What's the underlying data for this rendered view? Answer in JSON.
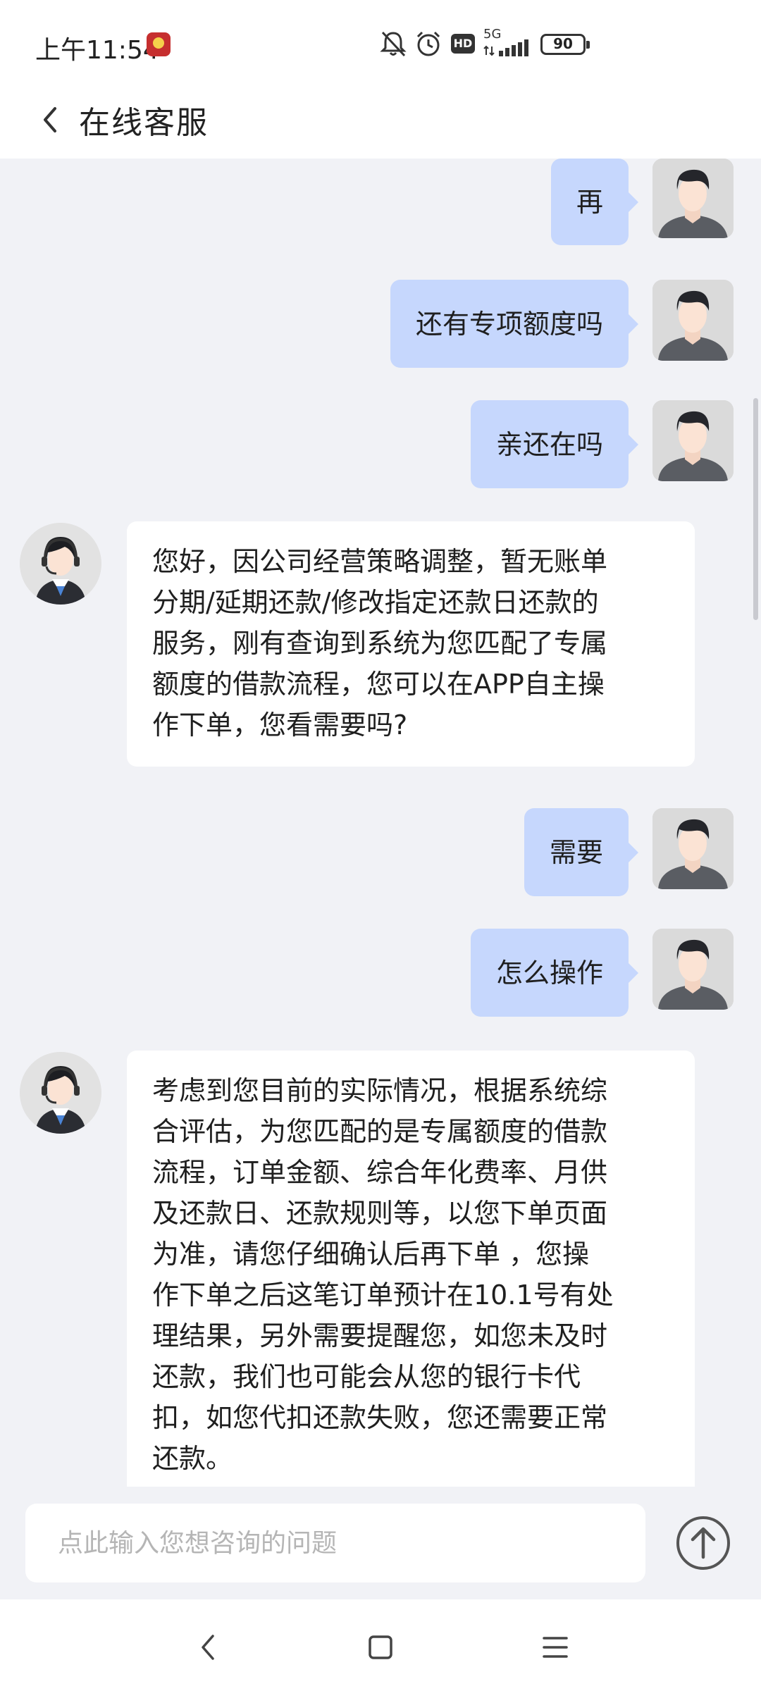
{
  "status_bar": {
    "time": "上午11:54",
    "network": "5G",
    "battery": "90",
    "icons": [
      "app-notification-icon",
      "mute-bell-icon",
      "alarm-icon",
      "hd-icon",
      "signal-icon",
      "battery-icon"
    ]
  },
  "header": {
    "title": "在线客服",
    "back_icon": "chevron-left-icon"
  },
  "messages": [
    {
      "from": "user",
      "text": "再"
    },
    {
      "from": "user",
      "text": "还有专项额度吗"
    },
    {
      "from": "user",
      "text": "亲还在吗"
    },
    {
      "from": "agent",
      "lines": [
        "您好，因公司经营策略调整，暂无账单",
        "分期/延期还款/修改指定还款日还款的",
        "服务，刚有查询到系统为您匹配了专属",
        "额度的借款流程，您可以在APP自主操",
        "作下单，您看需要吗?"
      ]
    },
    {
      "from": "user",
      "text": "需要"
    },
    {
      "from": "user",
      "text": "怎么操作"
    },
    {
      "from": "agent",
      "lines": [
        "考虑到您目前的实际情况，根据系统综",
        "合评估，为您匹配的是专属额度的借款",
        "流程，订单金额、综合年化费率、月供",
        "及还款日、还款规则等，以您下单页面",
        "为准，请您仔细确认后再下单 ，您操",
        "作下单之后这笔订单预计在10.1号有处",
        "理结果，另外需要提醒您，如您未及时",
        "还款，我们也可能会从您的银行卡代",
        "扣，如您代扣还款失败，您还需要正常",
        "还款。"
      ]
    }
  ],
  "input": {
    "placeholder": "点此输入您想咨询的问题",
    "value": "",
    "send_icon": "arrow-up-circle-icon"
  },
  "nav_bar": {
    "icons": [
      "back-triangle-icon",
      "home-square-icon",
      "menu-lines-icon"
    ]
  },
  "colors": {
    "user_bubble": "#c6d7fd",
    "agent_bubble": "#ffffff",
    "background": "#f1f2f6"
  }
}
